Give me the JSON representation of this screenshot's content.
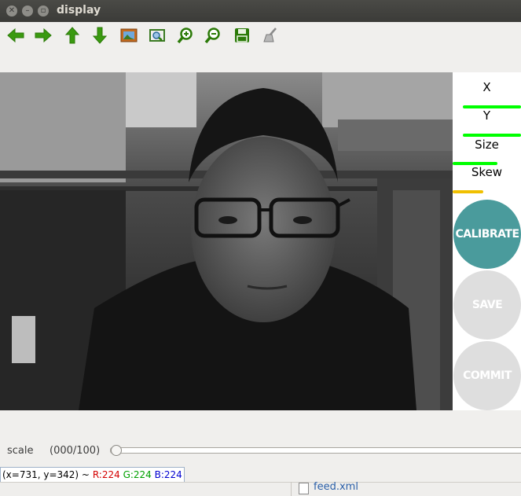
{
  "window": {
    "title": "display"
  },
  "toolbar": {
    "icons": [
      "arrow-left-icon",
      "arrow-right-icon",
      "arrow-up-icon",
      "arrow-down-icon",
      "image-icon",
      "zoom-fit-icon",
      "zoom-in-icon",
      "zoom-out-icon",
      "save-icon",
      "clear-icon"
    ]
  },
  "panel": {
    "x_label": "X",
    "y_label": "Y",
    "size_label": "Size",
    "skew_label": "Skew",
    "x_level": 0.85,
    "y_level": 0.85,
    "size_level": 0.65,
    "skew_level": 0.45,
    "bar_colors": {
      "x": "#00ff00",
      "y": "#00ff00",
      "size": "#00ff00",
      "skew": "#f0c000"
    },
    "calibrate_label": "CALIBRATE",
    "save_label": "SAVE",
    "commit_label": "COMMIT",
    "calibrate_color": "#4a9b9c",
    "inactive_color": "#dedede"
  },
  "trackbar": {
    "name": "scale",
    "value_text": "(000/100)",
    "value": 0
  },
  "status": {
    "coords": "(x=731, y=342) ~",
    "r": "R:224",
    "g": "G:224",
    "b": "B:224"
  },
  "below": {
    "file_label": "feed.xml"
  }
}
